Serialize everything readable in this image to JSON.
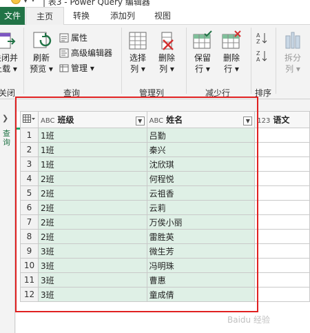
{
  "titlebar": {
    "title": "| 表3 - Power Query 编辑器"
  },
  "tabs": [
    {
      "label": "文件"
    },
    {
      "label": "主页"
    },
    {
      "label": "转换"
    },
    {
      "label": "添加列"
    },
    {
      "label": "视图"
    }
  ],
  "ribbon": {
    "close_load": {
      "line1": "关闭并",
      "line2": "上载 ▾"
    },
    "close_group": "关闭",
    "refresh": {
      "line1": "刷新",
      "line2": "预览 ▾"
    },
    "properties": "属性",
    "advanced_editor": "高级编辑器",
    "manage": "管理 ▾",
    "query_group": "查询",
    "choose_cols": {
      "line1": "选择",
      "line2": "列 ▾"
    },
    "remove_cols": {
      "line1": "删除",
      "line2": "列 ▾"
    },
    "manage_cols_group": "管理列",
    "keep_rows": {
      "line1": "保留",
      "line2": "行 ▾"
    },
    "remove_rows": {
      "line1": "删除",
      "line2": "行 ▾"
    },
    "reduce_rows_group": "减少行",
    "sort_group": "排序",
    "split_col": {
      "line1": "拆分",
      "line2": "列 ▾"
    }
  },
  "left_strip": {
    "label": "查询"
  },
  "table": {
    "columns": [
      {
        "type": "ABC",
        "name": "班级"
      },
      {
        "type": "ABC",
        "name": "姓名"
      },
      {
        "type": "123",
        "name": "语文"
      }
    ],
    "rows": [
      {
        "n": "1",
        "class": "1班",
        "name": "吕勤"
      },
      {
        "n": "2",
        "class": "1班",
        "name": "秦兴"
      },
      {
        "n": "3",
        "class": "1班",
        "name": "沈欣琪"
      },
      {
        "n": "4",
        "class": "2班",
        "name": "何程悦"
      },
      {
        "n": "5",
        "class": "2班",
        "name": "云祖香"
      },
      {
        "n": "6",
        "class": "2班",
        "name": "云莉"
      },
      {
        "n": "7",
        "class": "2班",
        "name": "万俟小丽"
      },
      {
        "n": "8",
        "class": "2班",
        "name": "雷胜英"
      },
      {
        "n": "9",
        "class": "3班",
        "name": "微生芳"
      },
      {
        "n": "10",
        "class": "3班",
        "name": "冯明珠"
      },
      {
        "n": "11",
        "class": "3班",
        "name": "曹惠"
      },
      {
        "n": "12",
        "class": "3班",
        "name": "童成倩"
      }
    ]
  },
  "watermark": "Baidu 经验",
  "colors": {
    "accent_green": "#217346",
    "selection_green": "#dff0e6",
    "highlight_red": "#e02020"
  }
}
